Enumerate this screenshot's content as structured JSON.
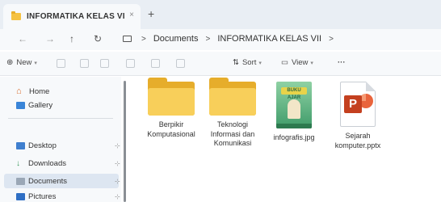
{
  "tab": {
    "title": "INFORMATIKA KELAS VI",
    "close": "×",
    "add": "+"
  },
  "nav": {
    "back": "←",
    "forward": "→",
    "up": "↑",
    "refresh": "↻"
  },
  "breadcrumb": {
    "items": [
      "Documents",
      "INFORMATIKA KELAS VII"
    ],
    "separator": ">"
  },
  "toolbar": {
    "new_label": "New",
    "sort_label": "Sort",
    "view_label": "View",
    "more": "···"
  },
  "sidebar": {
    "items": [
      {
        "label": "Home"
      },
      {
        "label": "Gallery"
      },
      {
        "label": "Desktop",
        "pin": "⊹"
      },
      {
        "label": "Downloads",
        "pin": "⊹"
      },
      {
        "label": "Documents",
        "pin": "⊹"
      },
      {
        "label": "Pictures",
        "pin": "⊹"
      }
    ]
  },
  "files": [
    {
      "label": "Berpikir Komputasional",
      "type": "folder"
    },
    {
      "label": "Teknologi Informasi dan Komunikasi",
      "type": "folder"
    },
    {
      "label": "infografis.jpg",
      "type": "image",
      "cover_text": "BUKU AJAR"
    },
    {
      "label": "Sejarah komputer.pptx",
      "type": "pptx",
      "badge": "P"
    }
  ],
  "colors": {
    "folder": "#f8cf5a",
    "accent": "#0067c0",
    "selected": "#dde6f1",
    "pptx": "#c4401f"
  }
}
